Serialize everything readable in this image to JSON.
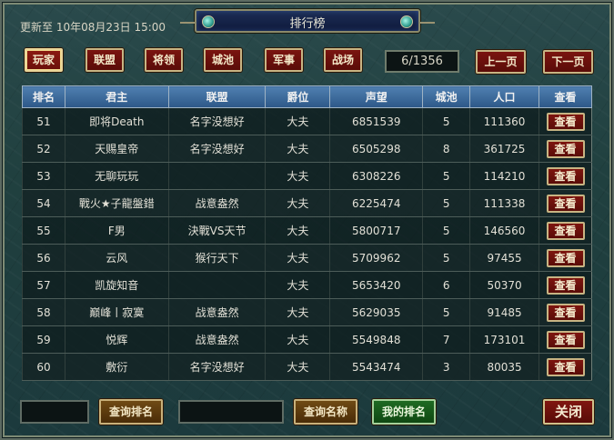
{
  "title": "排行榜",
  "update_text": "更新至 10年08月23日 15:00",
  "categories": [
    {
      "label": "玩家",
      "active": true
    },
    {
      "label": "联盟",
      "active": false
    },
    {
      "label": "将领",
      "active": false
    },
    {
      "label": "城池",
      "active": false
    },
    {
      "label": "军事",
      "active": false
    },
    {
      "label": "战场",
      "active": false
    }
  ],
  "pagination": {
    "page": "6/1356",
    "prev_label": "上一页",
    "next_label": "下一页"
  },
  "table": {
    "columns": [
      "排名",
      "君主",
      "联盟",
      "爵位",
      "声望",
      "城池",
      "人口",
      "查看"
    ],
    "view_label": "查看",
    "rows": [
      {
        "rank": "51",
        "lord": "即将Death",
        "alliance": "名字没想好",
        "title": "大夫",
        "prestige": "6851539",
        "cities": "5",
        "population": "111360"
      },
      {
        "rank": "52",
        "lord": "天赐皇帝",
        "alliance": "名字没想好",
        "title": "大夫",
        "prestige": "6505298",
        "cities": "8",
        "population": "361725"
      },
      {
        "rank": "53",
        "lord": "无聊玩玩",
        "alliance": "",
        "title": "大夫",
        "prestige": "6308226",
        "cities": "5",
        "population": "114210"
      },
      {
        "rank": "54",
        "lord": "戰火★子龍盤錯",
        "alliance": "战意盎然",
        "title": "大夫",
        "prestige": "6225474",
        "cities": "5",
        "population": "111338"
      },
      {
        "rank": "55",
        "lord": "F男",
        "alliance": "決戰VS天节",
        "title": "大夫",
        "prestige": "5800717",
        "cities": "5",
        "population": "146560"
      },
      {
        "rank": "56",
        "lord": "云风",
        "alliance": "猴行天下",
        "title": "大夫",
        "prestige": "5709962",
        "cities": "5",
        "population": "97455"
      },
      {
        "rank": "57",
        "lord": "凯旋知音",
        "alliance": "",
        "title": "大夫",
        "prestige": "5653420",
        "cities": "6",
        "population": "50370"
      },
      {
        "rank": "58",
        "lord": "巅峰丨寂寞",
        "alliance": "战意盎然",
        "title": "大夫",
        "prestige": "5629035",
        "cities": "5",
        "population": "91485"
      },
      {
        "rank": "59",
        "lord": "悦辉",
        "alliance": "战意盎然",
        "title": "大夫",
        "prestige": "5549848",
        "cities": "7",
        "population": "173101"
      },
      {
        "rank": "60",
        "lord": "敷衍",
        "alliance": "名字没想好",
        "title": "大夫",
        "prestige": "5543474",
        "cities": "3",
        "population": "80035"
      }
    ]
  },
  "bottom": {
    "rank_input_value": "",
    "query_rank_label": "查询排名",
    "name_input_value": "",
    "query_name_label": "查询名称",
    "my_rank_label": "我的排名",
    "close_label": "关闭"
  }
}
